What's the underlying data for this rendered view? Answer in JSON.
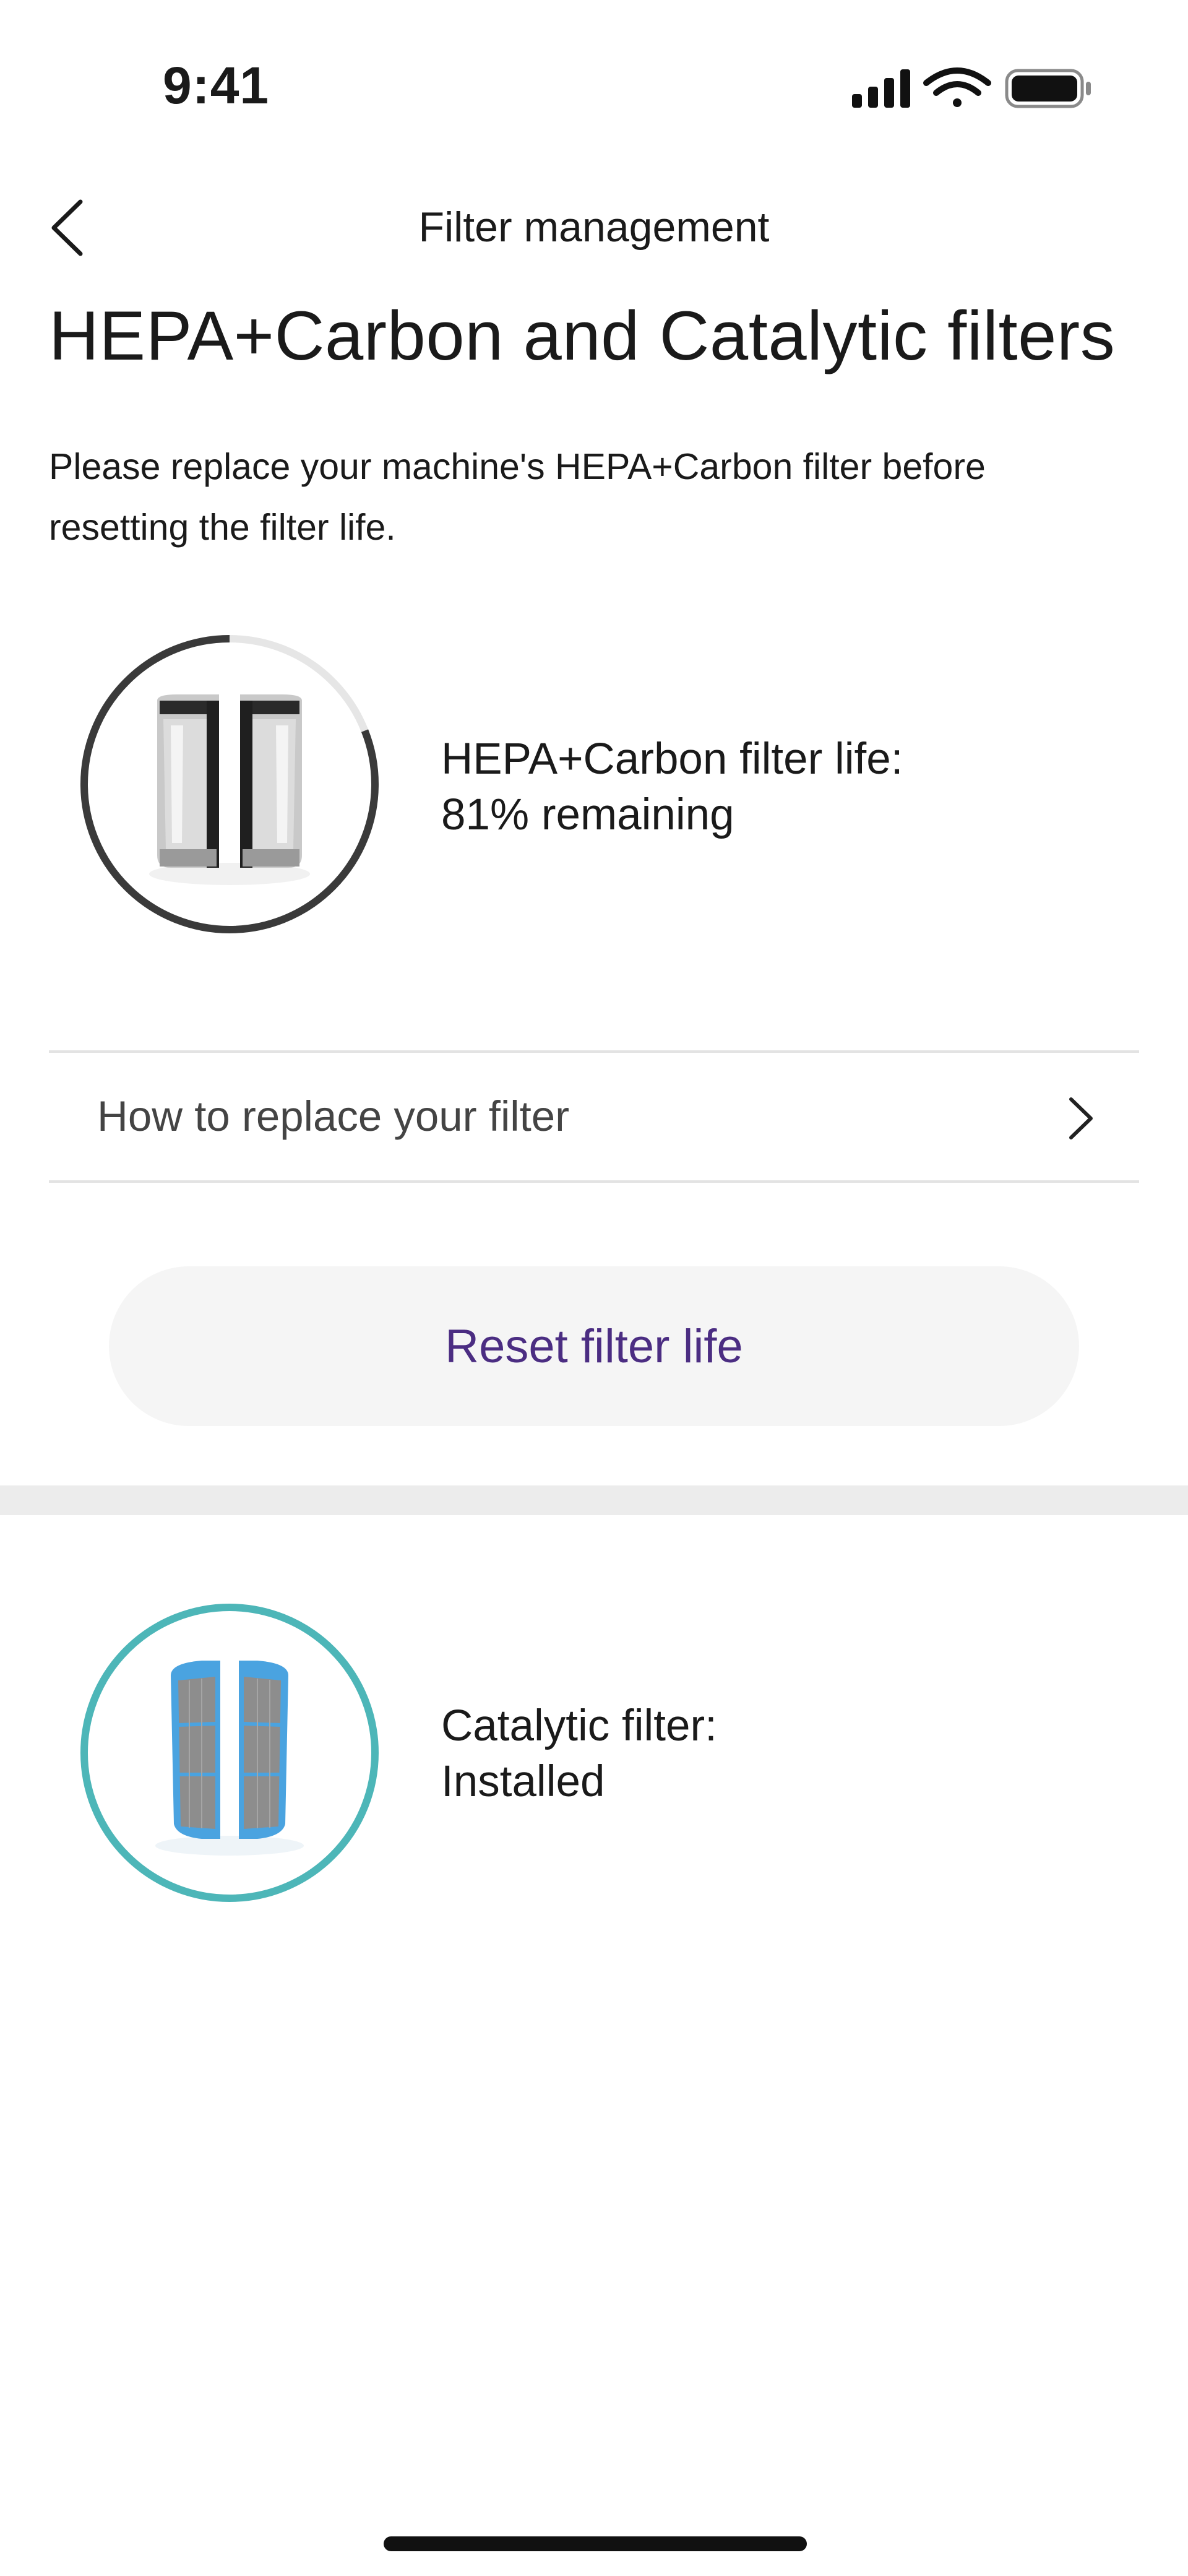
{
  "status_bar": {
    "time": "9:41"
  },
  "nav": {
    "title": "Filter management"
  },
  "heading": "HEPA+Carbon and Catalytic filters",
  "intro": "Please replace your machine's HEPA+Carbon filter before resetting the filter life.",
  "hepa": {
    "label": "HEPA+Carbon filter life:",
    "value": "81% remaining",
    "remaining_fraction": 0.81,
    "ring_color": "#3a3a3a",
    "track_color": "#e6e6e6"
  },
  "howto": {
    "label": "How to replace your filter"
  },
  "reset": {
    "label": "Reset filter life",
    "color": "#4b2d82"
  },
  "catalytic": {
    "label": "Catalytic filter:",
    "value": "Installed",
    "ring_color": "#4db6b8"
  },
  "icons": [
    "chevron-left-icon",
    "chevron-right-icon",
    "cellular-signal-icon",
    "wifi-icon",
    "battery-icon"
  ]
}
